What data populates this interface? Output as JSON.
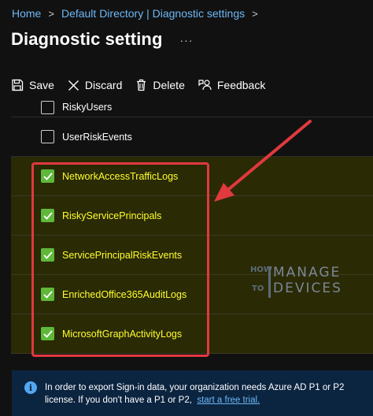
{
  "breadcrumb": {
    "items": [
      "Home",
      "Default Directory | Diagnostic settings"
    ],
    "separator": ">"
  },
  "header": {
    "title": "Diagnostic setting",
    "more_label": "···"
  },
  "toolbar": {
    "save_label": "Save",
    "discard_label": "Discard",
    "delete_label": "Delete",
    "feedback_label": "Feedback"
  },
  "log_categories": [
    {
      "label": "RiskyUsers",
      "checked": false
    },
    {
      "label": "UserRiskEvents",
      "checked": false
    },
    {
      "label": "NetworkAccessTrafficLogs",
      "checked": true
    },
    {
      "label": "RiskyServicePrincipals",
      "checked": true
    },
    {
      "label": "ServicePrincipalRiskEvents",
      "checked": true
    },
    {
      "label": "EnrichedOffice365AuditLogs",
      "checked": true
    },
    {
      "label": "MicrosoftGraphActivityLogs",
      "checked": true
    }
  ],
  "info": {
    "text": "In order to export Sign-in data, your organization needs Azure AD P1 or P2 license. If you don't have a P1 or P2,",
    "link_text": "start a free trial."
  },
  "watermark": {
    "how": "HOW",
    "to": "TO",
    "manage": "MANAGE",
    "devices": "DEVICES"
  },
  "colors": {
    "accent_link": "#6cb8f6",
    "checkbox_checked": "#5fb83a",
    "highlight_text": "#ffff2e",
    "highlight_box": "#e0393e",
    "info_banner_bg": "#0b2440"
  },
  "icons": {
    "save": "save-icon",
    "discard": "close-icon",
    "delete": "trash-icon",
    "feedback": "feedback-icon",
    "info": "info-icon",
    "annotation": "arrow-annotation"
  }
}
